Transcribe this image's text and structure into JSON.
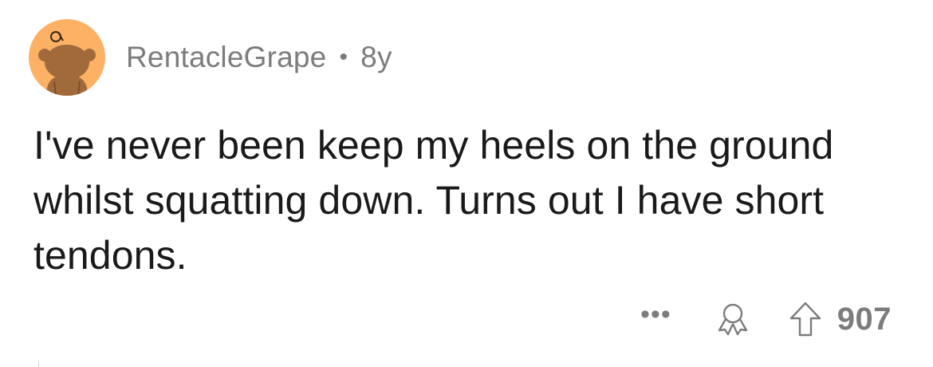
{
  "comment": {
    "username": "RentacleGrape",
    "separator": "•",
    "age": "8y",
    "text": "I've never been keep my heels on the ground whilst squatting down. Turns out I have short tendons.",
    "score": "907",
    "more_label": "•••"
  },
  "avatar": {
    "background_color": "#fdb165",
    "figure_color": "#a16a3b",
    "icon": "snoo-avatar"
  },
  "icons": {
    "award": "award-icon",
    "upvote": "upvote-arrow-icon"
  },
  "colors": {
    "text": "#1a1a1b",
    "meta": "#7c7c7c",
    "background": "#ffffff"
  }
}
